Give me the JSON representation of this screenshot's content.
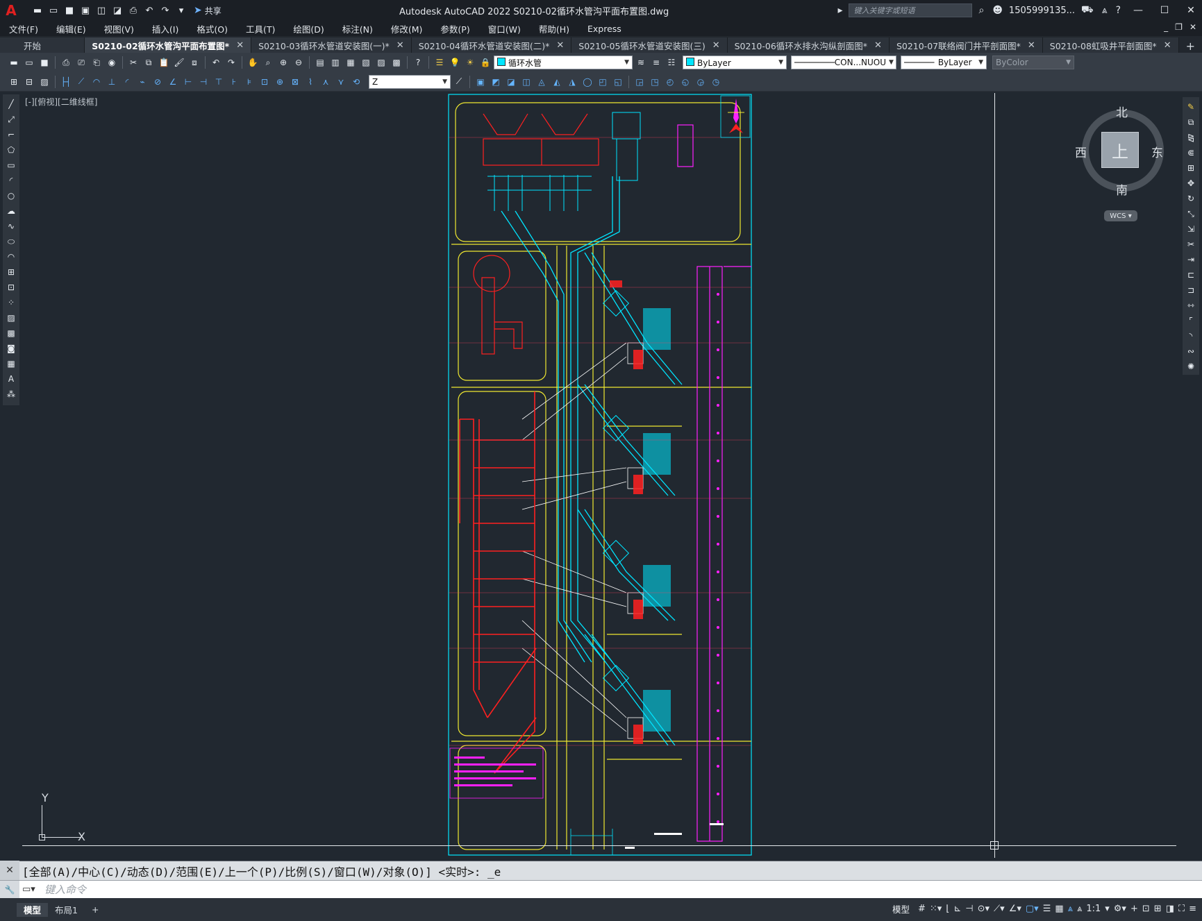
{
  "titlebar": {
    "app_title": "Autodesk AutoCAD 2022    S0210-02循环水管沟平面布置图.dwg",
    "share_label": "共享",
    "search_placeholder": "键入关键字或短语",
    "user": "1505999135..."
  },
  "menu": [
    "文件(F)",
    "编辑(E)",
    "视图(V)",
    "插入(I)",
    "格式(O)",
    "工具(T)",
    "绘图(D)",
    "标注(N)",
    "修改(M)",
    "参数(P)",
    "窗口(W)",
    "帮助(H)",
    "Express"
  ],
  "tabs": {
    "start": "开始",
    "items": [
      {
        "label": "S0210-02循环水管沟平面布置图*",
        "active": true
      },
      {
        "label": "S0210-03循环水管道安装图(一)*"
      },
      {
        "label": "S0210-04循环水管道安装图(二)*"
      },
      {
        "label": "S0210-05循环水管道安装图(三)"
      },
      {
        "label": "S0210-06循环水排水沟纵剖面图*"
      },
      {
        "label": "S0210-07联络阀门井平剖面图*"
      },
      {
        "label": "S0210-08虹吸井平剖面图*"
      }
    ]
  },
  "toolbar": {
    "layer_value": "循环水管",
    "layer_color": "#00e5ff",
    "color_value": "ByLayer",
    "linetype_value": "CON...NUOU",
    "lineweight_value": "ByLayer",
    "plotstyle_value": "ByColor",
    "ucs_value": "Z"
  },
  "viewport": {
    "label": "[-][俯视][二维线框]"
  },
  "viewcube": {
    "north": "北",
    "south": "南",
    "east": "东",
    "west": "西",
    "face": "上",
    "wcs": "WCS"
  },
  "ucs_icon": {
    "x_label": "X",
    "y_label": "Y"
  },
  "command": {
    "history": "[全部(A)/中心(C)/动态(D)/范围(E)/上一个(P)/比例(S)/窗口(W)/对象(O)] <实时>: _e",
    "placeholder": "键入命令"
  },
  "status": {
    "layout_tabs": [
      "模型",
      "布局1"
    ],
    "model_label": "模型",
    "scale": "1:1"
  }
}
